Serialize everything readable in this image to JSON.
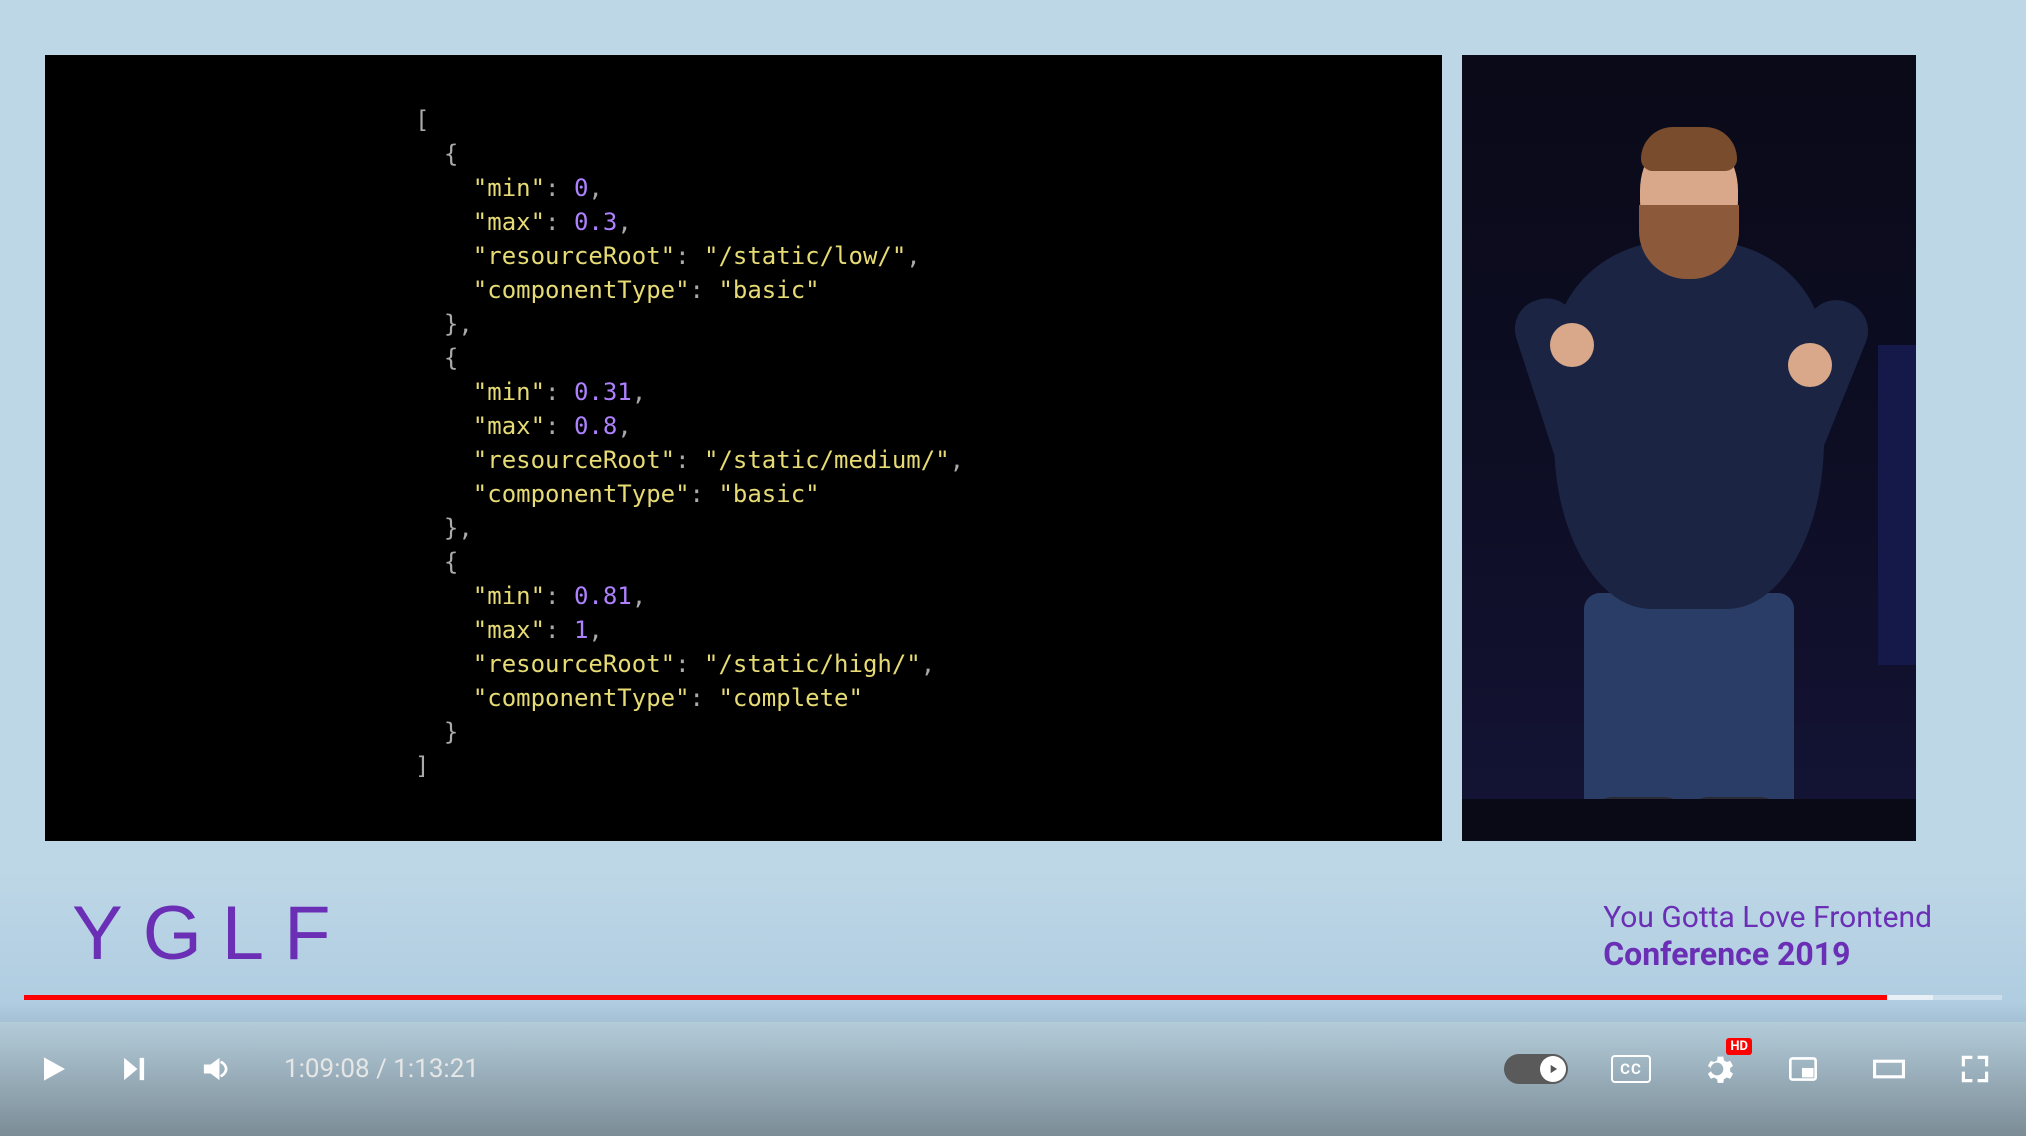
{
  "slide": {
    "code_items": [
      {
        "min": 0,
        "max": 0.3,
        "resourceRoot": "/static/low/",
        "componentType": "basic"
      },
      {
        "min": 0.31,
        "max": 0.8,
        "resourceRoot": "/static/medium/",
        "componentType": "basic"
      },
      {
        "min": 0.81,
        "max": 1,
        "resourceRoot": "/static/high/",
        "componentType": "complete"
      }
    ]
  },
  "branding": {
    "logo": "YGLF",
    "line1": "You Gotta Love Frontend",
    "line2": "Conference 2019"
  },
  "player": {
    "current_time": "1:09:08",
    "duration": "1:13:21",
    "time_separator": " / ",
    "progress_percent": 94.2,
    "loaded_percent": 96.5,
    "cc_label": "CC",
    "hd_label": "HD"
  }
}
